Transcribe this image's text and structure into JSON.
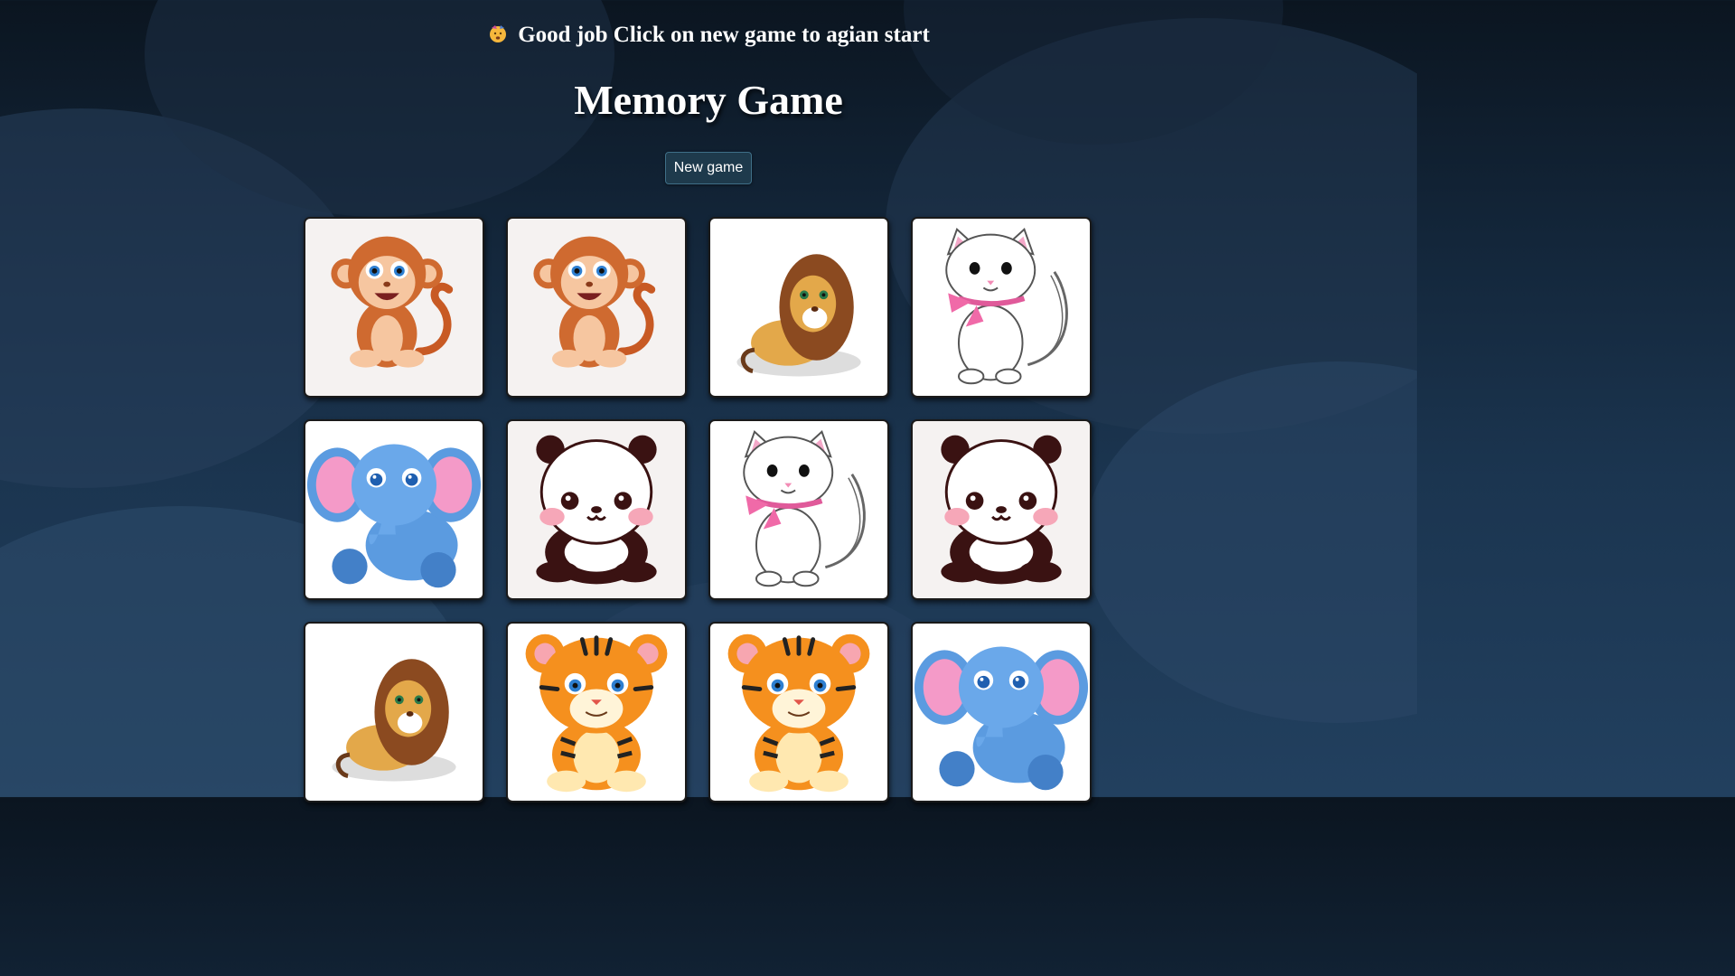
{
  "status_message": "Good job Click on new game to agian start",
  "title": "Memory Game",
  "new_game_label": "New game",
  "cards": [
    {
      "animal": "monkey",
      "bg": "#f5f2f1"
    },
    {
      "animal": "monkey",
      "bg": "#f5f2f1"
    },
    {
      "animal": "lion",
      "bg": "#ffffff"
    },
    {
      "animal": "cat",
      "bg": "#ffffff"
    },
    {
      "animal": "elephant",
      "bg": "#ffffff"
    },
    {
      "animal": "panda",
      "bg": "#f5f2f1"
    },
    {
      "animal": "cat",
      "bg": "#ffffff"
    },
    {
      "animal": "panda",
      "bg": "#f5f2f1"
    },
    {
      "animal": "lion",
      "bg": "#ffffff"
    },
    {
      "animal": "tiger",
      "bg": "#ffffff"
    },
    {
      "animal": "tiger",
      "bg": "#ffffff"
    },
    {
      "animal": "elephant",
      "bg": "#ffffff"
    }
  ]
}
